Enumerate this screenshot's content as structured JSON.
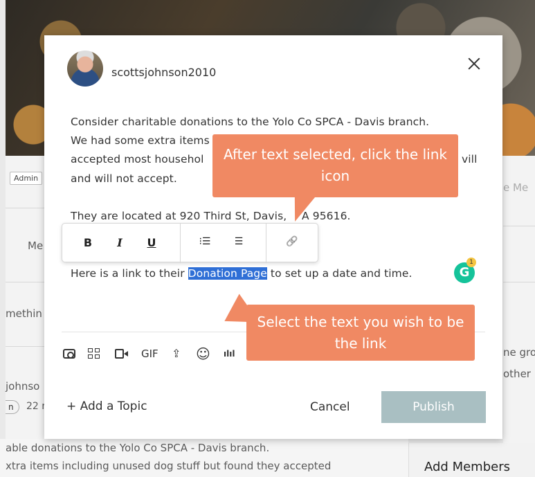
{
  "background": {
    "admin_badge": "Admin",
    "left_fragments": [
      "Me",
      "methin",
      "johnso",
      "22 r"
    ],
    "pill_text": "n",
    "right_fragments": [
      "e Me",
      "ne gro",
      "other r"
    ],
    "bottom_lines": [
      "able donations to the Yolo Co SPCA - Davis branch.",
      "xtra items including unused dog stuff but found they accepted"
    ],
    "add_members": "Add Members"
  },
  "modal": {
    "username": "scottsjohnson2010",
    "close_label": "×",
    "post_lines": [
      "Consider charitable donations to the Yolo Co SPCA - Davis branch.",
      "We had some extra items",
      "accepted most househol",
      "and will not accept.",
      "They are located at 920 Third St, Davis,",
      "A  95616."
    ],
    "post_line_right_fragment": "vill",
    "link_line": {
      "before": "Here is a link to their ",
      "selected": "Donation Page",
      "after": " to set up a date and time."
    },
    "format_toolbar": {
      "bold": "B",
      "italic": "I",
      "underline": "U",
      "numbered_list": "⁝☰",
      "bulleted_list": "☰",
      "link": "🔗"
    },
    "grammarly": {
      "letter": "G",
      "count": "1"
    },
    "media_toolbar": {
      "gif": "GIF",
      "upload": "⇪",
      "emoji": "☺",
      "poll": "ılıl"
    },
    "add_topic": "+ Add a Topic",
    "cancel": "Cancel",
    "publish": "Publish"
  },
  "callouts": {
    "link_hint": "After text selected, click the link icon",
    "select_hint": "Select the text you wish to be the link"
  },
  "colors": {
    "callout": "#f08963",
    "selection": "#2f6fd6",
    "publish_disabled": "#a9bfc2",
    "grammarly": "#15c39a"
  }
}
